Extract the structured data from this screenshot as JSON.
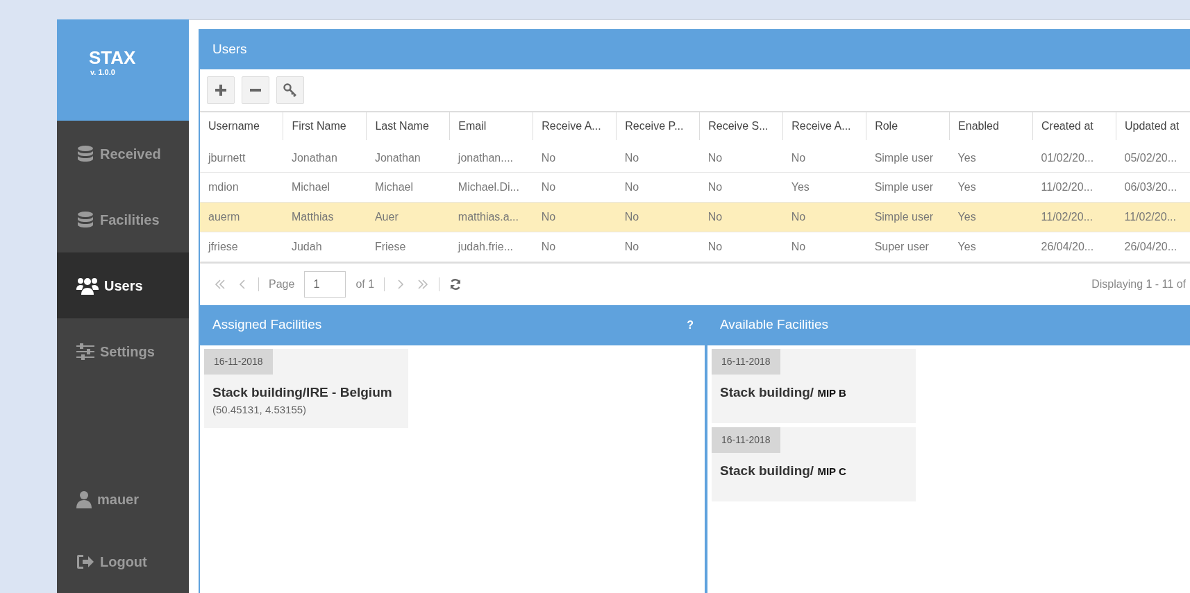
{
  "app": {
    "name": "STAX",
    "version": "v. 1.0.0"
  },
  "sidebar": {
    "items": [
      {
        "label": "Received",
        "kind": "database",
        "selected": false
      },
      {
        "label": "Facilities",
        "kind": "database",
        "selected": false
      },
      {
        "label": "Users",
        "kind": "users",
        "selected": true
      },
      {
        "label": "Settings",
        "kind": "sliders",
        "selected": false
      }
    ],
    "bottom": [
      {
        "label": "mauer",
        "kind": "user"
      },
      {
        "label": "Logout",
        "kind": "logout"
      }
    ]
  },
  "users_panel": {
    "title": "Users",
    "toolbar": [
      {
        "kind": "add"
      },
      {
        "kind": "remove"
      },
      {
        "kind": "key"
      }
    ],
    "table": {
      "columns": [
        "Username",
        "First Name",
        "Last Name",
        "Email",
        "Receive A...",
        "Receive P...",
        "Receive S...",
        "Receive A...",
        "Role",
        "Enabled",
        "Created at",
        "Updated at"
      ],
      "rows": [
        {
          "selected": false,
          "cells": [
            "jburnett",
            "Jonathan",
            "Jonathan",
            "jonathan....",
            "No",
            "No",
            "No",
            "No",
            "Simple user",
            "Yes",
            "01/02/20...",
            "05/02/20..."
          ]
        },
        {
          "selected": false,
          "cells": [
            "mdion",
            "Michael",
            "Michael",
            "Michael.Di...",
            "No",
            "No",
            "No",
            "Yes",
            "Simple user",
            "Yes",
            "11/02/20...",
            "06/03/20..."
          ]
        },
        {
          "selected": true,
          "cells": [
            "auerm",
            "Matthias",
            "Auer",
            "matthias.a...",
            "No",
            "No",
            "No",
            "No",
            "Simple user",
            "Yes",
            "11/02/20...",
            "11/02/20..."
          ]
        },
        {
          "selected": false,
          "cells": [
            "jfriese",
            "Judah",
            "Friese",
            "judah.frie...",
            "No",
            "No",
            "No",
            "No",
            "Super user",
            "Yes",
            "26/04/20...",
            "26/04/20..."
          ]
        }
      ]
    },
    "pager": {
      "page_label": "Page",
      "page": "1",
      "of": "of 1",
      "summary": "Displaying 1 - 11 of"
    }
  },
  "assigned": {
    "title": "Assigned Facilities",
    "help": "?",
    "cards": [
      {
        "date": "16-11-2018",
        "title": "Stack building/IRE - Belgium",
        "coords": "(50.45131, 4.53155)"
      }
    ]
  },
  "available": {
    "title": "Available Facilities",
    "cards": [
      {
        "date": "16-11-2018",
        "title": "Stack building/",
        "suffix": "MIP B"
      },
      {
        "date": "16-11-2018",
        "title": "Stack building/",
        "suffix": "MIP C"
      }
    ]
  }
}
